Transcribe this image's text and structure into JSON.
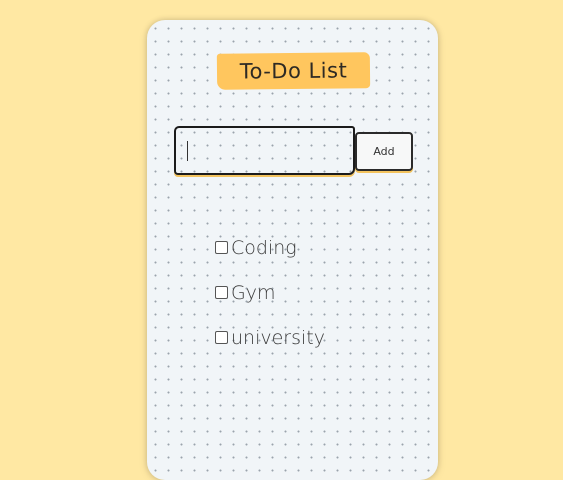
{
  "app": {
    "title": "To-Do List"
  },
  "form": {
    "input_value": "",
    "input_placeholder": "",
    "add_label": "Add"
  },
  "todos": [
    {
      "label": "Coding",
      "checked": false
    },
    {
      "label": "Gym",
      "checked": false
    },
    {
      "label": "university",
      "checked": false
    }
  ],
  "colors": {
    "background": "#ffe8a3",
    "card": "#f1f5f8",
    "title_highlight": "#ffc65e",
    "text": "#3a3a3a"
  }
}
